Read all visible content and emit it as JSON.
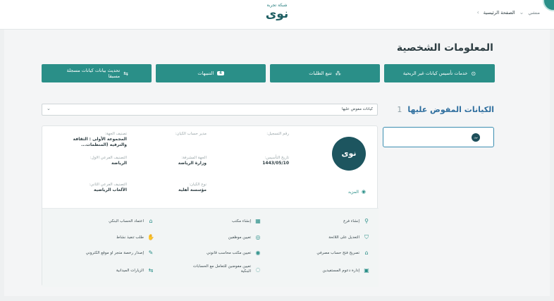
{
  "header": {
    "brand_small": "شبكة تجربة",
    "brand_logo": "نوى",
    "breadcrumb": [
      "منشي",
      "الصفحة الرئيسية"
    ]
  },
  "page": {
    "title": "المعلومات الشخصية"
  },
  "actions": [
    {
      "label": "خدمات تأسيس كيانات غير الربحية",
      "icon": "plus-circle-icon"
    },
    {
      "label": "تتبع الطلبات",
      "icon": "tracking-icon"
    },
    {
      "label": "التنبيهات",
      "icon": "bell-icon",
      "badge": "4"
    },
    {
      "label": "تحديث بيانات كيانات مسجلة مسبقا",
      "icon": "transfer-icon"
    }
  ],
  "entities": {
    "title": "الكيانات المفوض عليها",
    "count": "1",
    "dropdown_value": "كيانات مفوض عليها"
  },
  "entity_card": {
    "logo_text": "نوى",
    "more_label": "المزيد",
    "fields": {
      "reg_date_label": "رقم التسجيل:",
      "reg_date_value": "",
      "manager_label": "مدير حساب الكيان:",
      "manager_value": "",
      "class_label": "تصنيف الجهة:",
      "class_value": "المجموعة الأولى : الثقافة والترفيه (المنظمات...",
      "founding_label": "تاريخ التأسيس:",
      "founding_value": "1443/05/10",
      "sponsor_label": "الجهة المشرفة:",
      "sponsor_value": "وزارة الرياضة",
      "sub1_label": "التصنيف الفرعي الاول:",
      "sub1_value": "الرياضة",
      "type_label": "نوع الكيان:",
      "type_value": "مؤسسة أهلية",
      "sub2_label": "التصنيف الفرعي الثاني:",
      "sub2_value": "الألعاب الرياضية"
    }
  },
  "services": [
    {
      "label": "إنشاء فرع",
      "icon": "branch-icon"
    },
    {
      "label": "إنشاء مكتب",
      "icon": "building-icon"
    },
    {
      "label": "اعتماد الحساب البنكي",
      "icon": "bank-icon"
    },
    {
      "label": "التعديل على اللائحة",
      "icon": "shield-check-icon"
    },
    {
      "label": "تعيين موظفين",
      "icon": "employee-icon"
    },
    {
      "label": "طلب تنفيذ نشاط",
      "icon": "hand-icon"
    },
    {
      "label": "تصريح فتح حساب مصرفي",
      "icon": "bank-permit-icon"
    },
    {
      "label": "تعيين مكتب محاسب قانوني",
      "icon": "accountant-icon"
    },
    {
      "label": "إصدار رخصة متجر او موقع الكتروني",
      "icon": "license-icon"
    },
    {
      "label": "إدارة دعوم المستفيدين",
      "icon": "support-icon"
    },
    {
      "label": "تعيين مفوضين للتعامل مع الحسابات البنكية",
      "icon": "delegate-icon"
    },
    {
      "label": "الزيارات الميدانية",
      "icon": "visits-icon"
    }
  ]
}
